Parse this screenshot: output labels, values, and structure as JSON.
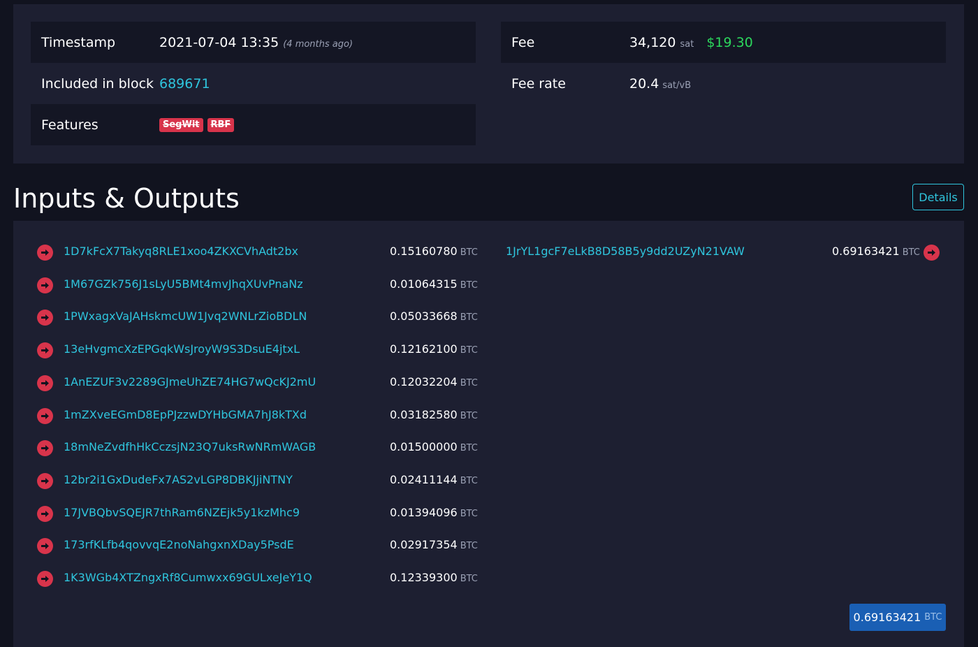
{
  "details": {
    "timestamp_label": "Timestamp",
    "timestamp_value": "2021-07-04 13:35",
    "timestamp_relative": "(4 months ago)",
    "block_label": "Included in block",
    "block_value": "689671",
    "features_label": "Features",
    "features": [
      "SegWit",
      "RBF"
    ],
    "fee_label": "Fee",
    "fee_value": "34,120",
    "fee_unit": "sat",
    "fee_usd": "$19.30",
    "fee_rate_label": "Fee rate",
    "fee_rate_value": "20.4",
    "fee_rate_unit": "sat/vB"
  },
  "io": {
    "title": "Inputs & Outputs",
    "details_button": "Details",
    "inputs": [
      {
        "address": "1D7kFcX7Takyq8RLE1xoo4ZKXCVhAdt2bx",
        "amount": "0.15160780",
        "unit": "BTC"
      },
      {
        "address": "1M67GZk756J1sLyU5BMt4mvJhqXUvPnaNz",
        "amount": "0.01064315",
        "unit": "BTC"
      },
      {
        "address": "1PWxagxVaJAHskmcUW1Jvq2WNLrZioBDLN",
        "amount": "0.05033668",
        "unit": "BTC"
      },
      {
        "address": "13eHvgmcXzEPGqkWsJroyW9S3DsuE4jtxL",
        "amount": "0.12162100",
        "unit": "BTC"
      },
      {
        "address": "1AnEZUF3v2289GJmeUhZE74HG7wQcKJ2mU",
        "amount": "0.12032204",
        "unit": "BTC"
      },
      {
        "address": "1mZXveEGmD8EpPJzzwDYHbGMA7hJ8kTXd",
        "amount": "0.03182580",
        "unit": "BTC"
      },
      {
        "address": "18mNeZvdfhHkCczsjN23Q7uksRwNRmWAGB",
        "amount": "0.01500000",
        "unit": "BTC"
      },
      {
        "address": "12br2i1GxDudeFx7AS2vLGP8DBKJjiNTNY",
        "amount": "0.02411144",
        "unit": "BTC"
      },
      {
        "address": "17JVBQbvSQEJR7thRam6NZEjk5y1kzMhc9",
        "amount": "0.01394096",
        "unit": "BTC"
      },
      {
        "address": "173rfKLfb4qovvqE2noNahgxnXDay5PsdE",
        "amount": "0.02917354",
        "unit": "BTC"
      },
      {
        "address": "1K3WGb4XTZngxRf8Cumwxx69GULxeJeY1Q",
        "amount": "0.12339300",
        "unit": "BTC"
      }
    ],
    "outputs": [
      {
        "address": "1JrYL1gcF7eLkB8D58B5y9dd2UZyN21VAW",
        "amount": "0.69163421",
        "unit": "BTC"
      }
    ],
    "total_amount": "0.69163421",
    "total_unit": "BTC"
  },
  "colors": {
    "background": "#11131f",
    "panel": "#1d1f31",
    "link": "#2fc5dd",
    "arrow": "#d8344b",
    "usd": "#2cd65c",
    "total_badge": "#1a5fb4"
  }
}
